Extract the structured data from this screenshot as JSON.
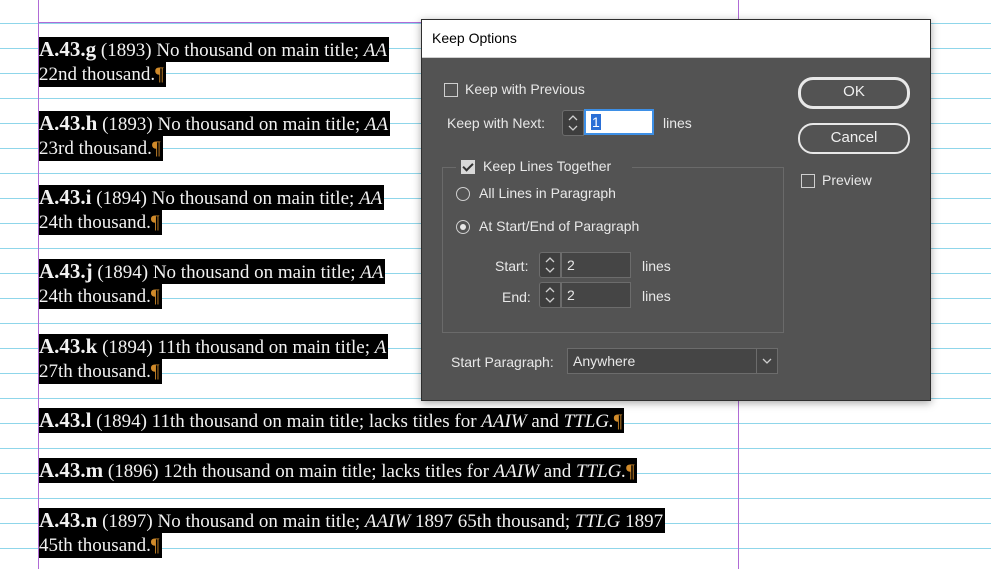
{
  "document": {
    "entries": [
      {
        "id": "A.43.g",
        "line1": " (1893) No thousand on main title; ",
        "line1_tail": "AA",
        "line2": "22nd thousand."
      },
      {
        "id": "A.43.h",
        "line1": " (1893) No thousand on main title; ",
        "line1_tail": "AA",
        "line2": "23rd thousand."
      },
      {
        "id": "A.43.i",
        "line1": " (1894) No thousand on main title; ",
        "line1_tail": "AA",
        "line2": "24th thousand."
      },
      {
        "id": "A.43.j",
        "line1": " (1894) No thousand on main title; ",
        "line1_tail": "AA",
        "line2": "24th thousand."
      },
      {
        "id": "A.43.k",
        "line1": " (1894) 11th thousand on main title; ",
        "line1_tail": "A",
        "line2": "27th thousand."
      },
      {
        "id": "A.43.l",
        "line1": " (1894) 11th thousand on main title; lacks titles for ",
        "it1": "AAIW",
        "mid": " and ",
        "it2": "TTLG."
      },
      {
        "id": "A.43.m",
        "line1": " (1896) 12th thousand on main title; lacks titles for ",
        "it1": "AAIW",
        "mid": " and ",
        "it2": "TTLG."
      },
      {
        "id": "A.43.n",
        "line1": " (1897) No thousand on main title; ",
        "it1": "AAIW",
        "mid": " 1897 65th thousand; ",
        "it2": "TTLG",
        "tail": " 1897",
        "line2": "45th thousand."
      }
    ],
    "pilcrow": "¶"
  },
  "dialog": {
    "title": "Keep Options",
    "keep_with_previous": {
      "label": "Keep with Previous",
      "checked": false
    },
    "keep_with_next": {
      "label": "Keep with Next:",
      "value": "1",
      "unit": "lines"
    },
    "keep_lines_together": {
      "label": "Keep Lines Together",
      "checked": true
    },
    "all_lines": {
      "label": "All Lines in Paragraph",
      "selected": false
    },
    "start_end": {
      "label": "At Start/End of Paragraph",
      "selected": true
    },
    "start": {
      "label": "Start:",
      "value": "2",
      "unit": "lines"
    },
    "end": {
      "label": "End:",
      "value": "2",
      "unit": "lines"
    },
    "start_paragraph": {
      "label": "Start Paragraph:",
      "value": "Anywhere"
    },
    "ok_label": "OK",
    "cancel_label": "Cancel",
    "preview": {
      "label": "Preview",
      "checked": false
    }
  }
}
